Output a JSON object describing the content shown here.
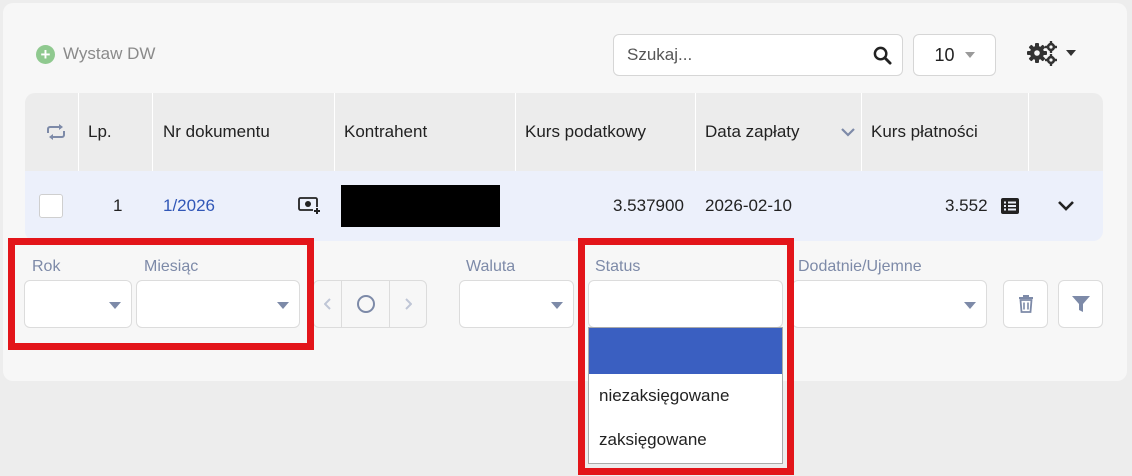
{
  "toolbar": {
    "add_label": "Wystaw DW",
    "search_placeholder": "Szukaj...",
    "page_size": "10"
  },
  "table": {
    "headers": [
      "Lp.",
      "Nr dokumentu",
      "Kontrahent",
      "Kurs podatkowy",
      "Data zapłaty",
      "Kurs płatności"
    ],
    "sorted_column": "Data zapłaty",
    "rows": [
      {
        "lp": "1",
        "nr": "1/2026",
        "kontrahent": "",
        "kurs_podatkowy": "3.537900",
        "data_zaplaty": "2026-02-10",
        "kurs_platnosci": "3.552"
      }
    ]
  },
  "filters": {
    "rok_label": "Rok",
    "miesiac_label": "Miesiąc",
    "waluta_label": "Waluta",
    "status_label": "Status",
    "dodatnie_label": "Dodatnie/Ujemne",
    "status_options": [
      "",
      "niezaksięgowane",
      "zaksięgowane"
    ]
  },
  "colors": {
    "accent": "#3a5fc1",
    "link": "#3157b7",
    "highlight": "#e3151a",
    "add_icon": "#8fc98f"
  }
}
